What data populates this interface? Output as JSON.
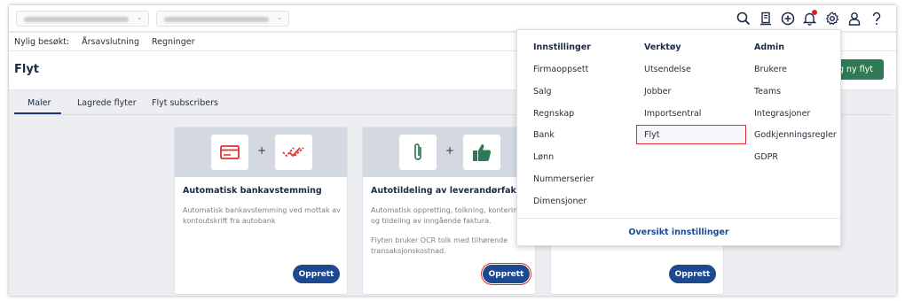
{
  "topbar": {
    "icons": [
      "search-icon",
      "archive-icon",
      "add-circle-icon",
      "bell-icon",
      "gear-icon",
      "user-icon",
      "help-icon"
    ]
  },
  "recent": {
    "label": "Nylig besøkt:",
    "links": [
      "Årsavslutning",
      "Regninger"
    ]
  },
  "page": {
    "title": "Flyt",
    "new_button_label": "Lag ny flyt"
  },
  "tabs": [
    "Maler",
    "Lagrede flyter",
    "Flyt subscribers"
  ],
  "cards": [
    {
      "title": "Automatisk bankavstemming",
      "text1": "Automatisk bankavstemming ved mottak av kontoutskrift fra autobank",
      "text2": "",
      "button": "Opprett"
    },
    {
      "title": "Autotildeling av leverandørfaktura",
      "text1": "Automatisk oppretting, tolkning, kontering og tildeling av inngående faktura.",
      "text2": "Flyten bruker OCR tolk med tilhørende transaksjonskostnad.",
      "button": "Opprett"
    },
    {
      "button": "Opprett"
    }
  ],
  "menu": {
    "columns": [
      {
        "title": "Innstillinger",
        "items": [
          "Firmaoppsett",
          "Salg",
          "Regnskap",
          "Bank",
          "Lønn",
          "Nummerserier",
          "Dimensjoner"
        ]
      },
      {
        "title": "Verktøy",
        "items": [
          "Utsendelse",
          "Jobber",
          "Importsentral",
          "Flyt"
        ]
      },
      {
        "title": "Admin",
        "items": [
          "Brukere",
          "Teams",
          "Integrasjoner",
          "Godkjenningsregler",
          "GDPR"
        ]
      }
    ],
    "overview_label": "Oversikt innstillinger"
  },
  "colors": {
    "primary": "#1d4a8e",
    "green": "#2f7a54",
    "highlight": "#e0302e"
  }
}
